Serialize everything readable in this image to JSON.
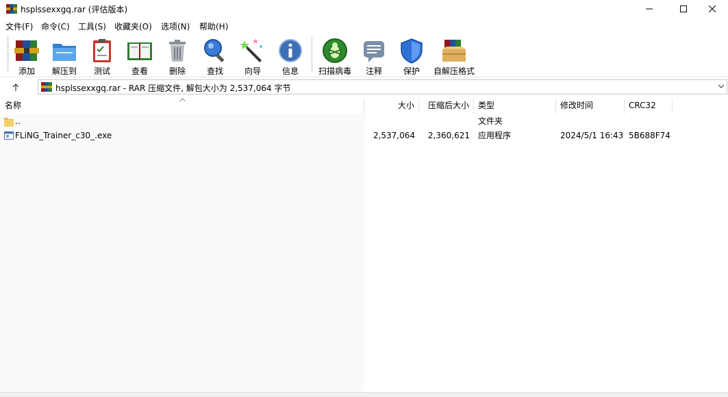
{
  "window": {
    "title": "hsplssexxgq.rar (评估版本)"
  },
  "menu": [
    "文件(F)",
    "命令(C)",
    "工具(S)",
    "收藏夹(O)",
    "选项(N)",
    "帮助(H)"
  ],
  "toolbar": {
    "add": "添加",
    "extract": "解压到",
    "test": "测试",
    "view": "查看",
    "delete": "删除",
    "find": "查找",
    "wizard": "向导",
    "info": "信息",
    "scan": "扫描病毒",
    "comment": "注释",
    "protect": "保护",
    "sfx": "自解压格式"
  },
  "address": {
    "text": "hsplssexxgq.rar - RAR 压缩文件, 解包大小为 2,537,064 字节"
  },
  "columns": {
    "name": "名称",
    "size": "大小",
    "packed": "压缩后大小",
    "type": "类型",
    "modified": "修改时间",
    "crc": "CRC32"
  },
  "rows": [
    {
      "name": "..",
      "size": "",
      "packed": "",
      "type": "文件夹",
      "modified": "",
      "crc": ""
    },
    {
      "name": "FLiNG_Trainer_c30_.exe",
      "size": "2,537,064",
      "packed": "2,360,621",
      "type": "应用程序",
      "modified": "2024/5/1 16:43",
      "crc": "5B688F74"
    }
  ]
}
